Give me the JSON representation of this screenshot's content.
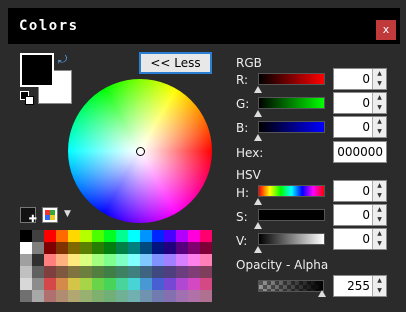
{
  "window": {
    "title": "Colors",
    "close_label": "x"
  },
  "toolbar": {
    "less_label": "<< Less"
  },
  "icons": {
    "swap": "swap-colors-icon",
    "reset": "reset-colors-icon",
    "close": "close-icon"
  },
  "rgb": {
    "section_label": "RGB",
    "r_label": "R:",
    "r_value": "0",
    "g_label": "G:",
    "g_value": "0",
    "b_label": "B:",
    "b_value": "0",
    "hex_label": "Hex:",
    "hex_value": "000000"
  },
  "hsv": {
    "section_label": "HSV",
    "h_label": "H:",
    "h_value": "0",
    "s_label": "S:",
    "s_value": "0",
    "v_label": "V:",
    "v_value": "0"
  },
  "alpha": {
    "section_label": "Opacity - Alpha",
    "value": "255"
  },
  "colors": {
    "primary": "#000000",
    "secondary": "#ffffff",
    "accent": "#2a7fd4",
    "close": "#c0393b"
  },
  "palette_rows": [
    [
      "#000000",
      "#404040",
      "#ff0000",
      "#ff6a00",
      "#ffd800",
      "#b6ff00",
      "#4cff00",
      "#00ff21",
      "#00ff90",
      "#00ffff",
      "#0094ff",
      "#0026ff",
      "#4800ff",
      "#b200ff",
      "#ff00dc",
      "#ff006e"
    ],
    [
      "#ffffff",
      "#808080",
      "#7f0000",
      "#7f3300",
      "#7f6a00",
      "#5b7f00",
      "#267f00",
      "#007f0e",
      "#007f46",
      "#007f7f",
      "#004a7f",
      "#00137f",
      "#21007f",
      "#57007f",
      "#7f006e",
      "#7f0037"
    ],
    [
      "#a0a0a0",
      "#303030",
      "#ff7f7f",
      "#ffb27f",
      "#ffe97f",
      "#daff7f",
      "#a5ff7f",
      "#7fff8e",
      "#7fffc5",
      "#7fffff",
      "#7fc9ff",
      "#7f92ff",
      "#a17fff",
      "#d67fff",
      "#ff7fed",
      "#ff7fb6"
    ],
    [
      "#c0c0c0",
      "#606060",
      "#7f3f3f",
      "#7f593f",
      "#7f743f",
      "#6d7f3f",
      "#527f3f",
      "#3f7f47",
      "#3f7f62",
      "#3f7f7f",
      "#3f647f",
      "#3f497f",
      "#503f7f",
      "#6b3f7f",
      "#7f3f76",
      "#7f3f5b"
    ],
    [
      "#d8d8d8",
      "#8c8c8c",
      "#d4484a",
      "#d48a48",
      "#d4c548",
      "#a8d448",
      "#6ad448",
      "#48d458",
      "#48d49b",
      "#48d4d4",
      "#4898d4",
      "#485fd4",
      "#7648d4",
      "#b048d4",
      "#d448c3",
      "#d44884"
    ],
    [
      "#707070",
      "#a8a8a8",
      "#b07070",
      "#b08c70",
      "#b0a870",
      "#98b070",
      "#80b070",
      "#70b078",
      "#70b094",
      "#70b0b0",
      "#7094b0",
      "#707cb0",
      "#8470b0",
      "#a070b0",
      "#b070a8",
      "#b07090"
    ]
  ]
}
